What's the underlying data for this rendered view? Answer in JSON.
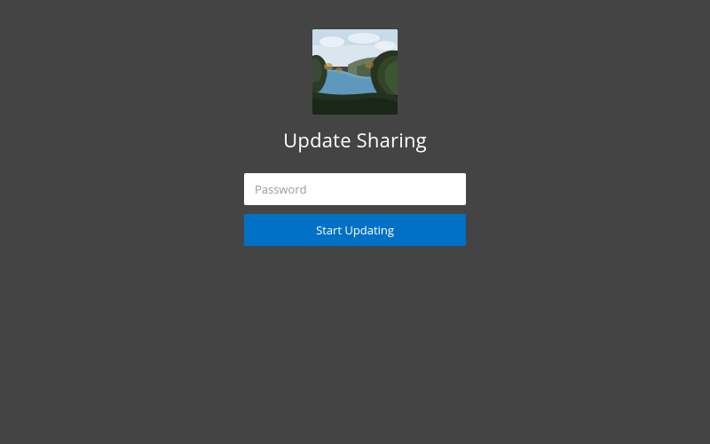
{
  "title": "Update Sharing",
  "form": {
    "password_placeholder": "Password",
    "password_value": "",
    "submit_label": "Start Updating"
  },
  "thumbnail": {
    "alt": "landscape-thumbnail"
  }
}
